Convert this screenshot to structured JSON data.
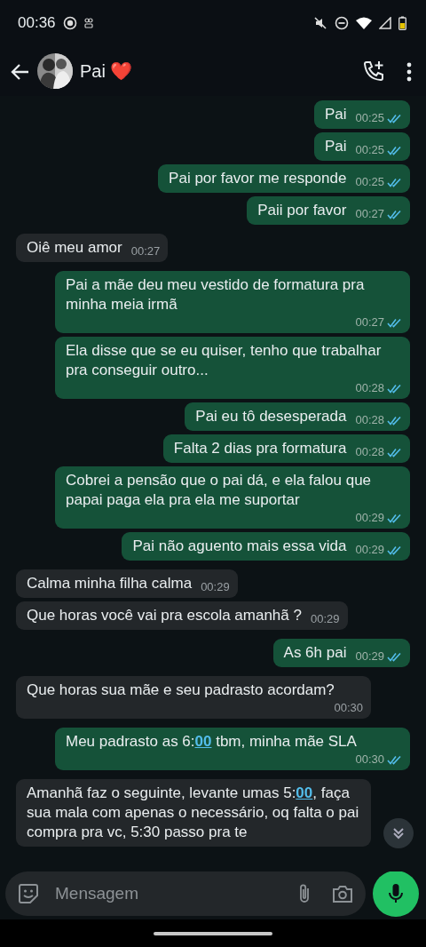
{
  "status_bar": {
    "time": "00:36"
  },
  "header": {
    "contact_name": "Pai ❤️"
  },
  "messages": [
    {
      "outgoing": true,
      "time": "00:25",
      "read": true,
      "segments": [
        {
          "kind": "plain",
          "text": "Pai"
        }
      ]
    },
    {
      "outgoing": true,
      "time": "00:25",
      "read": true,
      "segments": [
        {
          "kind": "plain",
          "text": "Pai"
        }
      ]
    },
    {
      "outgoing": true,
      "time": "00:25",
      "read": true,
      "segments": [
        {
          "kind": "plain",
          "text": "Pai por favor me responde"
        }
      ]
    },
    {
      "outgoing": true,
      "time": "00:27",
      "read": true,
      "segments": [
        {
          "kind": "plain",
          "text": "Paii por favor"
        }
      ]
    },
    {
      "outgoing": false,
      "time": "00:27",
      "segments": [
        {
          "kind": "plain",
          "text": "Oiê meu amor"
        }
      ]
    },
    {
      "outgoing": true,
      "time": "00:27",
      "read": true,
      "segments": [
        {
          "kind": "plain",
          "text": "Pai a mãe deu meu vestido de formatura pra minha meia irmã"
        }
      ]
    },
    {
      "outgoing": true,
      "time": "00:28",
      "read": true,
      "segments": [
        {
          "kind": "plain",
          "text": "Ela disse que se eu quiser, tenho que trabalhar pra conseguir outro..."
        }
      ]
    },
    {
      "outgoing": true,
      "time": "00:28",
      "read": true,
      "segments": [
        {
          "kind": "plain",
          "text": "Pai eu tô desesperada"
        }
      ]
    },
    {
      "outgoing": true,
      "time": "00:28",
      "read": true,
      "segments": [
        {
          "kind": "plain",
          "text": "Falta 2 dias pra formatura"
        }
      ]
    },
    {
      "outgoing": true,
      "time": "00:29",
      "read": true,
      "segments": [
        {
          "kind": "plain",
          "text": "Cobrei a pensão que o pai dá, e ela falou que papai paga ela pra ela me suportar"
        }
      ]
    },
    {
      "outgoing": true,
      "time": "00:29",
      "read": true,
      "segments": [
        {
          "kind": "plain",
          "text": "Pai não aguento mais essa vida"
        }
      ]
    },
    {
      "outgoing": false,
      "time": "00:29",
      "segments": [
        {
          "kind": "plain",
          "text": "Calma minha filha calma"
        }
      ]
    },
    {
      "outgoing": false,
      "time": "00:29",
      "segments": [
        {
          "kind": "plain",
          "text": "Que horas você vai pra escola amanhã ?"
        }
      ]
    },
    {
      "outgoing": true,
      "time": "00:29",
      "read": true,
      "segments": [
        {
          "kind": "plain",
          "text": "As 6h pai"
        }
      ]
    },
    {
      "outgoing": false,
      "time": "00:30",
      "segments": [
        {
          "kind": "plain",
          "text": "Que horas sua mãe e seu padrasto acordam?"
        }
      ]
    },
    {
      "outgoing": true,
      "time": "00:30",
      "read": true,
      "segments": [
        {
          "kind": "plain",
          "text": "Meu padrasto as 6:"
        },
        {
          "kind": "link",
          "text": "00"
        },
        {
          "kind": "plain",
          "text": " tbm, minha mãe SLA"
        }
      ]
    },
    {
      "outgoing": false,
      "segments": [
        {
          "kind": "plain",
          "text": "Amanhã faz o seguinte, levante umas 5:"
        },
        {
          "kind": "link",
          "text": "00"
        },
        {
          "kind": "plain",
          "text": ", faça sua mala com apenas o necessário, oq falta o pai compra pra vc, 5:30 passo pra te"
        }
      ]
    }
  ],
  "composer": {
    "placeholder": "Mensagem"
  }
}
